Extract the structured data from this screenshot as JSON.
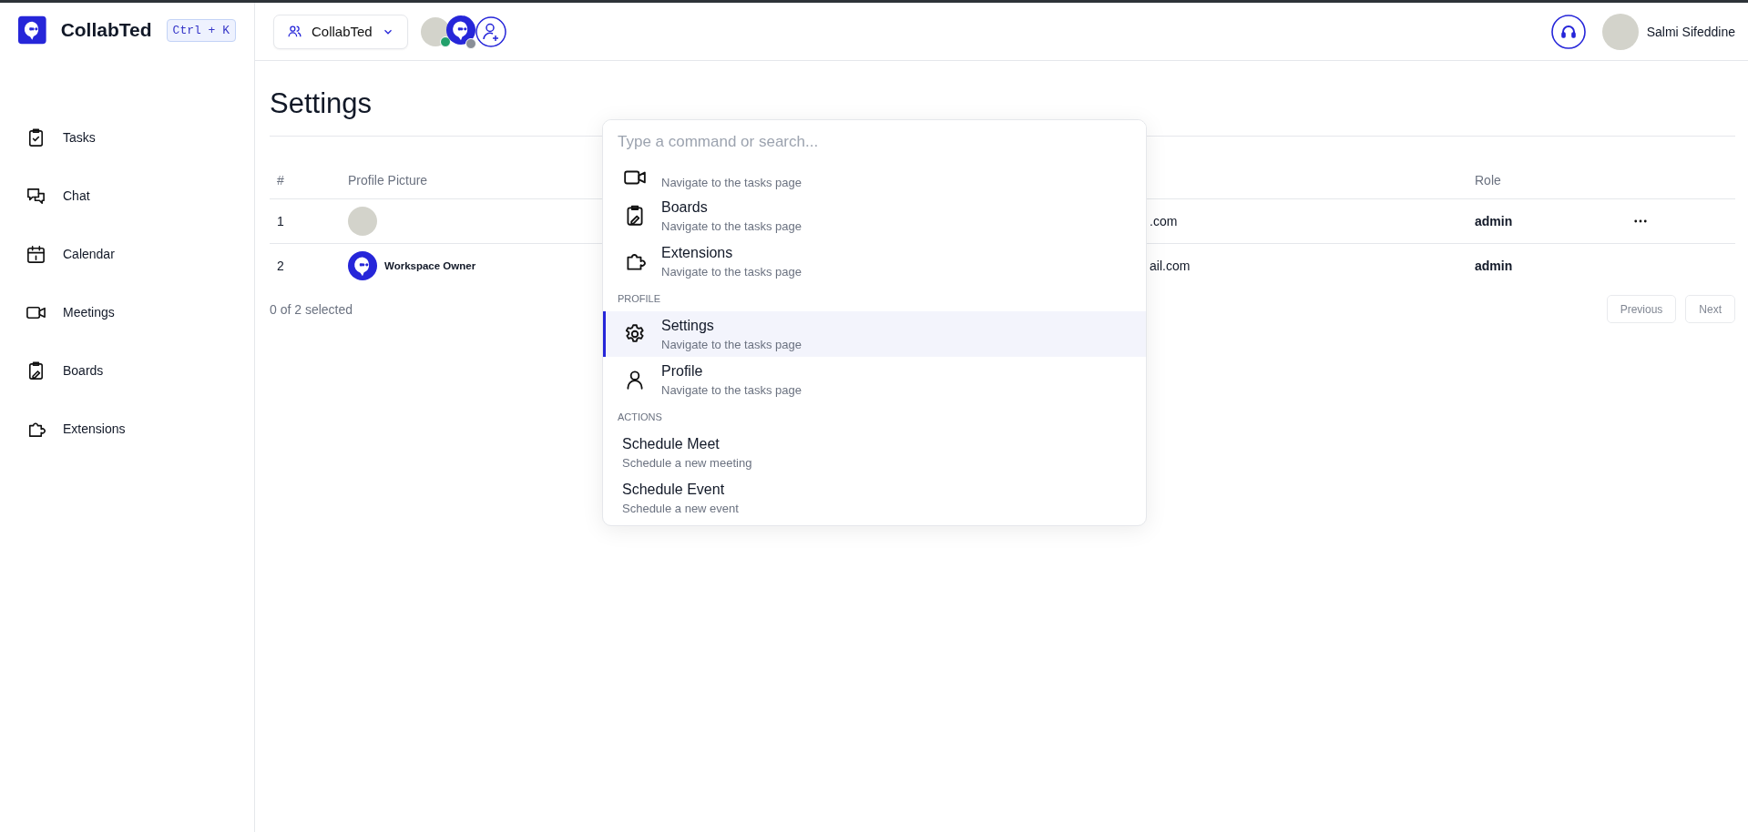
{
  "sidebar": {
    "brand": "CollabTed",
    "shortcut": "Ctrl + K",
    "items": [
      {
        "kind": "tasks",
        "label": "Tasks"
      },
      {
        "kind": "chat",
        "label": "Chat"
      },
      {
        "kind": "calendar",
        "label": "Calendar"
      },
      {
        "kind": "meetings",
        "label": "Meetings"
      },
      {
        "kind": "boards",
        "label": "Boards"
      },
      {
        "kind": "extensions",
        "label": "Extensions"
      }
    ]
  },
  "topbar": {
    "workspace": "CollabTed",
    "members": [
      {
        "kind": "photo",
        "color": "#22a06b"
      },
      {
        "kind": "logo",
        "color": "#8a8f98"
      }
    ],
    "user": {
      "name": "Salmi Sifeddine"
    }
  },
  "page": {
    "title": "Settings"
  },
  "table": {
    "columns": [
      "#",
      "Profile Picture",
      "Role"
    ],
    "rows": [
      {
        "number": "1",
        "avatar": {
          "kind": "photo"
        },
        "column_3": ".com",
        "role": "admin",
        "menu": true
      },
      {
        "number": "2",
        "avatar": {
          "kind": "logo"
        },
        "name": "Workspace Owner",
        "column_3": "ail.com",
        "role": "admin",
        "menu": false
      }
    ],
    "footer": "0 of 2 selected",
    "buttons": [
      {
        "label": "Previous",
        "disabled": true
      },
      {
        "label": "Next",
        "disabled": true
      }
    ]
  },
  "palette": {
    "placeholder": "Type a command or search...",
    "groups": [
      {
        "items": [
          {
            "kind": "meetings",
            "description": "Navigate to the tasks page",
            "selected": false
          },
          {
            "kind": "boards",
            "title": "Boards",
            "description": "Navigate to the tasks page",
            "selected": false
          },
          {
            "kind": "extensions",
            "title": "Extensions",
            "description": "Navigate to the tasks page",
            "selected": false
          }
        ]
      },
      {
        "heading": "PROFILE",
        "items": [
          {
            "kind": "settings",
            "title": "Settings",
            "description": "Navigate to the tasks page",
            "selected": true
          },
          {
            "kind": "profile",
            "title": "Profile",
            "description": "Navigate to the tasks page",
            "selected": false
          }
        ]
      },
      {
        "heading": "ACTIONS",
        "items": [
          {
            "kind": "action",
            "title": "Schedule Meet",
            "description": "Schedule a new meeting",
            "selected": false
          },
          {
            "kind": "action",
            "title": "Schedule Event",
            "description": "Schedule a new event",
            "selected": false
          }
        ]
      }
    ]
  }
}
